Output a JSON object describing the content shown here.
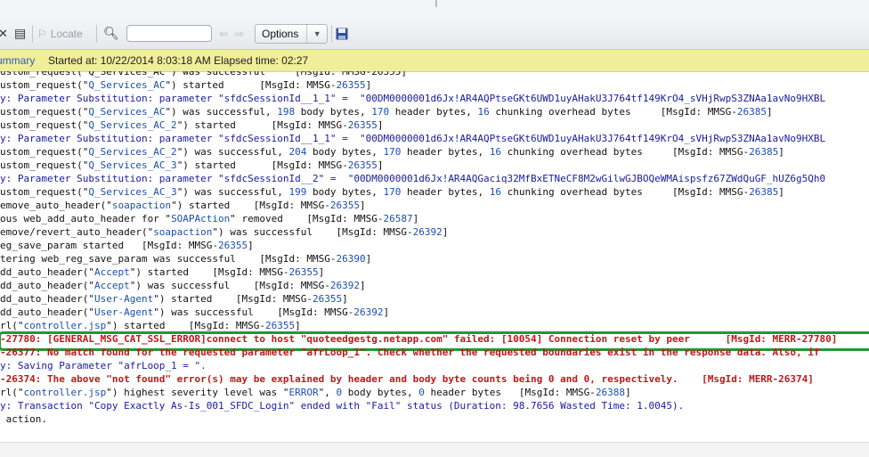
{
  "toolbar": {
    "locate_label": "Locate",
    "options_label": "Options",
    "search_value": ""
  },
  "summary": {
    "link": "ummary",
    "info": "Started at: 10/22/2014 8:03:18 AM Elapsed time: 02:27"
  },
  "log_lines": [
    {
      "cls": "partial",
      "segs": [
        [
          "",
          "ustom_request(\"Q_Services_AC\") was successful     [MsgId: MMSG-26355]"
        ]
      ]
    },
    {
      "segs": [
        [
          "",
          "ustom_request(\""
        ],
        [
          "s",
          "Q_Services_AC"
        ],
        [
          "",
          "\") started      [MsgId: MMSG-"
        ],
        [
          "s",
          "26355"
        ],
        [
          "",
          "]"
        ]
      ]
    },
    {
      "segs": [
        [
          "blue",
          "y: Parameter Substitution: parameter \"sfdcSessionId__1_1\" =  \"00DM0000001d6Jx!AR4AQPtseGKt6UWD1uyAHakU3J764tf149KrO4_sVHjRwpS3ZNAa1avNo9HXBL"
        ]
      ]
    },
    {
      "segs": [
        [
          "",
          "ustom_request(\""
        ],
        [
          "s",
          "Q_Services_AC"
        ],
        [
          "",
          "\") was successful, "
        ],
        [
          "s",
          "198"
        ],
        [
          "",
          " body bytes, "
        ],
        [
          "s",
          "170"
        ],
        [
          "",
          " header bytes, "
        ],
        [
          "s",
          "16"
        ],
        [
          "",
          " chunking overhead bytes     [MsgId: MMSG-"
        ],
        [
          "s",
          "26385"
        ],
        [
          "",
          "]"
        ]
      ]
    },
    {
      "segs": [
        [
          "",
          "ustom_request(\""
        ],
        [
          "s",
          "Q_Services_AC_2"
        ],
        [
          "",
          "\") started      [MsgId: MMSG-"
        ],
        [
          "s",
          "26355"
        ],
        [
          "",
          "]"
        ]
      ]
    },
    {
      "segs": [
        [
          "blue",
          "y: Parameter Substitution: parameter \"sfdcSessionId__1_1\" =  \"00DM0000001d6Jx!AR4AQPtseGKt6UWD1uyAHakU3J764tf149KrO4_sVHjRwpS3ZNAa1avNo9HXBL"
        ]
      ]
    },
    {
      "segs": [
        [
          "",
          "ustom_request(\""
        ],
        [
          "s",
          "Q_Services_AC_2"
        ],
        [
          "",
          "\") was successful, "
        ],
        [
          "s",
          "204"
        ],
        [
          "",
          " body bytes, "
        ],
        [
          "s",
          "170"
        ],
        [
          "",
          " header bytes, "
        ],
        [
          "s",
          "16"
        ],
        [
          "",
          " chunking overhead bytes     [MsgId: MMSG-"
        ],
        [
          "s",
          "26385"
        ],
        [
          "",
          "]"
        ]
      ]
    },
    {
      "segs": [
        [
          "",
          "ustom_request(\""
        ],
        [
          "s",
          "Q_Services_AC_3"
        ],
        [
          "",
          "\") started      [MsgId: MMSG-"
        ],
        [
          "s",
          "26355"
        ],
        [
          "",
          "]"
        ]
      ]
    },
    {
      "segs": [
        [
          "blue",
          "y: Parameter Substitution: parameter \"sfdcSessionId__2\" =  \"00DM0000001d6Jx!AR4AQGaciq32MfBxETNeCF8M2wGilwGJBOQeWMAispsfz67ZWdQuGF_hUZ6g5Qh0"
        ]
      ]
    },
    {
      "segs": [
        [
          "",
          "ustom_request(\""
        ],
        [
          "s",
          "Q_Services_AC_3"
        ],
        [
          "",
          "\") was successful, "
        ],
        [
          "s",
          "199"
        ],
        [
          "",
          " body bytes, "
        ],
        [
          "s",
          "170"
        ],
        [
          "",
          " header bytes, "
        ],
        [
          "s",
          "16"
        ],
        [
          "",
          " chunking overhead bytes     [MsgId: MMSG-"
        ],
        [
          "s",
          "26385"
        ],
        [
          "",
          "]"
        ]
      ]
    },
    {
      "segs": [
        [
          "",
          "emove_auto_header(\""
        ],
        [
          "s",
          "soapaction"
        ],
        [
          "",
          "\") started    [MsgId: MMSG-"
        ],
        [
          "s",
          "26355"
        ],
        [
          "",
          "]"
        ]
      ]
    },
    {
      "segs": [
        [
          "",
          "ous web_add_auto_header for \""
        ],
        [
          "s",
          "SOAPAction"
        ],
        [
          "",
          "\" removed    [MsgId: MMSG-"
        ],
        [
          "s",
          "26587"
        ],
        [
          "",
          "]"
        ]
      ]
    },
    {
      "segs": [
        [
          "",
          "emove/revert_auto_header(\""
        ],
        [
          "s",
          "soapaction"
        ],
        [
          "",
          "\") was successful    [MsgId: MMSG-"
        ],
        [
          "s",
          "26392"
        ],
        [
          "",
          "]"
        ]
      ]
    },
    {
      "segs": [
        [
          "",
          "eg_save_param started   [MsgId: MMSG-"
        ],
        [
          "s",
          "26355"
        ],
        [
          "",
          "]"
        ]
      ]
    },
    {
      "segs": [
        [
          "",
          "tering web_reg_save_param was successful    [MsgId: MMSG-"
        ],
        [
          "s",
          "26390"
        ],
        [
          "",
          "]"
        ]
      ]
    },
    {
      "segs": [
        [
          "",
          "dd_auto_header(\""
        ],
        [
          "s",
          "Accept"
        ],
        [
          "",
          "\") started    [MsgId: MMSG-"
        ],
        [
          "s",
          "26355"
        ],
        [
          "",
          "]"
        ]
      ]
    },
    {
      "segs": [
        [
          "",
          "dd_auto_header(\""
        ],
        [
          "s",
          "Accept"
        ],
        [
          "",
          "\") was successful    [MsgId: MMSG-"
        ],
        [
          "s",
          "26392"
        ],
        [
          "",
          "]"
        ]
      ]
    },
    {
      "segs": [
        [
          "",
          "dd_auto_header(\""
        ],
        [
          "s",
          "User-Agent"
        ],
        [
          "",
          "\") started    [MsgId: MMSG-"
        ],
        [
          "s",
          "26355"
        ],
        [
          "",
          "]"
        ]
      ]
    },
    {
      "segs": [
        [
          "",
          "dd_auto_header(\""
        ],
        [
          "s",
          "User-Agent"
        ],
        [
          "",
          "\") was successful    [MsgId: MMSG-"
        ],
        [
          "s",
          "26392"
        ],
        [
          "",
          "]"
        ]
      ]
    },
    {
      "segs": [
        [
          "",
          "rl(\""
        ],
        [
          "s",
          "controller.jsp"
        ],
        [
          "",
          "\") started    [MsgId: MMSG-"
        ],
        [
          "s",
          "26355"
        ],
        [
          "",
          "]"
        ]
      ]
    },
    {
      "segs": [
        [
          "err",
          "-27780: [GENERAL_MSG_CAT_SSL_ERROR]connect to host \"quoteedgestg.netapp.com\" failed: [10054] Connection reset by peer      [MsgId: MERR-27780]"
        ]
      ]
    },
    {
      "segs": [
        [
          "err",
          "-26377: No match found for the requested parameter \"afrLoop_1\". Check whether the requested boundaries exist in the response data. Also, if"
        ]
      ]
    },
    {
      "segs": [
        [
          "blue",
          "y: Saving Parameter \"afrLoop_1 = \"."
        ]
      ]
    },
    {
      "segs": [
        [
          "err",
          "-26374: The above \"not found\" error(s) may be explained by header and body byte counts being 0 and 0, respectively.    [MsgId: MERR-26374]"
        ]
      ]
    },
    {
      "segs": [
        [
          "",
          "rl(\""
        ],
        [
          "s",
          "controller.jsp"
        ],
        [
          "",
          "\") highest severity level was \""
        ],
        [
          "s",
          "ERROR"
        ],
        [
          "",
          "\", "
        ],
        [
          "s",
          "0"
        ],
        [
          "",
          " body bytes, "
        ],
        [
          "s",
          "0"
        ],
        [
          "",
          " header bytes   [MsgId: MMSG-"
        ],
        [
          "s",
          "26388"
        ],
        [
          "",
          "]"
        ]
      ]
    },
    {
      "segs": [
        [
          "blue",
          "y: Transaction \"Copy Exactly As-Is_001_SFDC_Login\" ended with \"Fail\" status (Duration: 98.7656 Wasted Time: 1.0045)."
        ]
      ]
    },
    {
      "segs": [
        [
          "",
          " action."
        ]
      ]
    }
  ]
}
